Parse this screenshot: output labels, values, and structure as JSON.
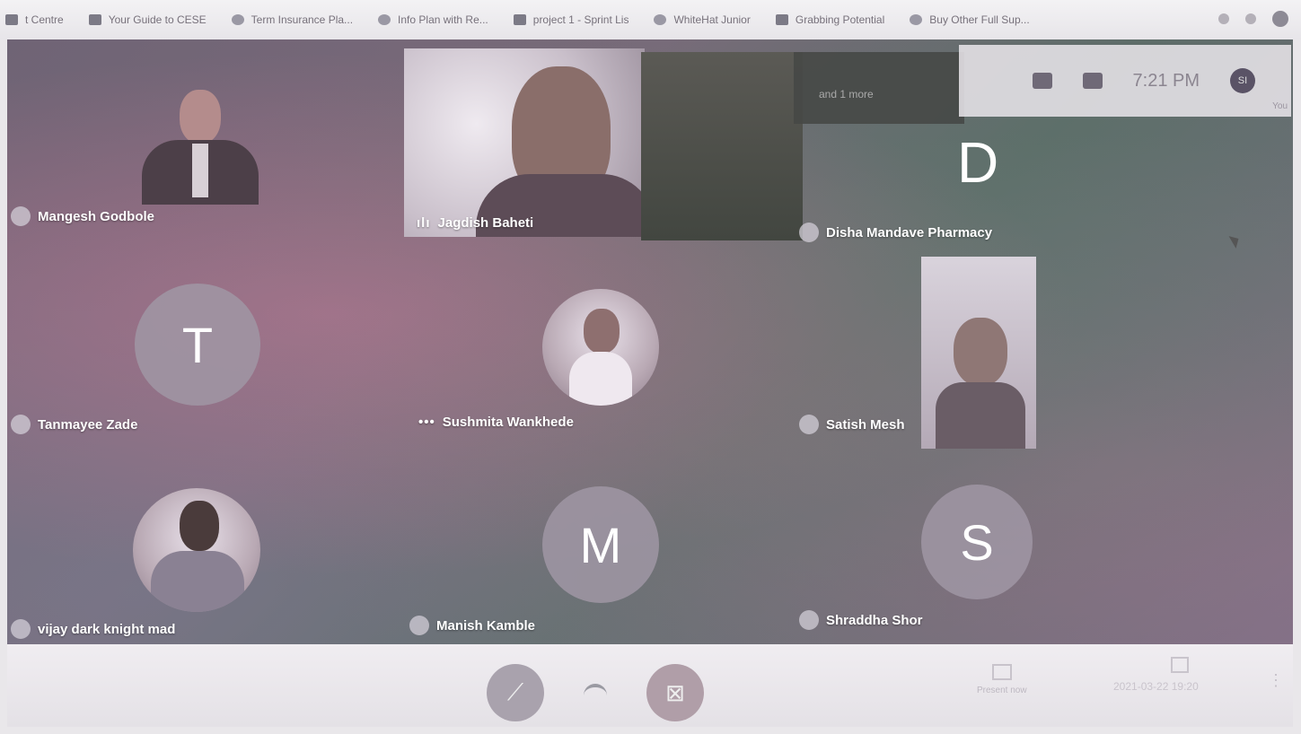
{
  "bookmarks": [
    {
      "label": "t Centre",
      "icon": "page-icon"
    },
    {
      "label": "Your Guide to CESE",
      "icon": "doc-icon"
    },
    {
      "label": "Term Insurance Pla...",
      "icon": "link-icon"
    },
    {
      "label": "Info Plan with Re...",
      "icon": "globe-icon"
    },
    {
      "label": "project 1 - Sprint Lis",
      "icon": "sheet-icon"
    },
    {
      "label": "WhiteHat Junior",
      "icon": "clock-icon"
    },
    {
      "label": "Grabbing Potential",
      "icon": "doc-icon"
    },
    {
      "label": "Buy Other Full Sup...",
      "icon": "tag-icon"
    }
  ],
  "meeting": {
    "time": "7:21 PM",
    "self_initials": "SI",
    "self_label": "You",
    "top_banner": "and 1 more",
    "participants": [
      {
        "name": "Mangesh Godbole"
      },
      {
        "name": "Jagdish Baheti"
      },
      {
        "name": "Disha Mandave Pharmacy",
        "letter": "D"
      },
      {
        "name": "Tanmayee Zade",
        "letter": "T"
      },
      {
        "name": "Sushmita Wankhede"
      },
      {
        "name": "Satish Mesh"
      },
      {
        "name": "vijay dark knight mad"
      },
      {
        "name": "Manish Kamble",
        "letter": "M"
      },
      {
        "name": "Shraddha Shor",
        "letter": "S"
      }
    ]
  },
  "bottom": {
    "present_label": "Present now",
    "timestamp": "2021-03-22 19:20",
    "more_label": "⋮"
  }
}
